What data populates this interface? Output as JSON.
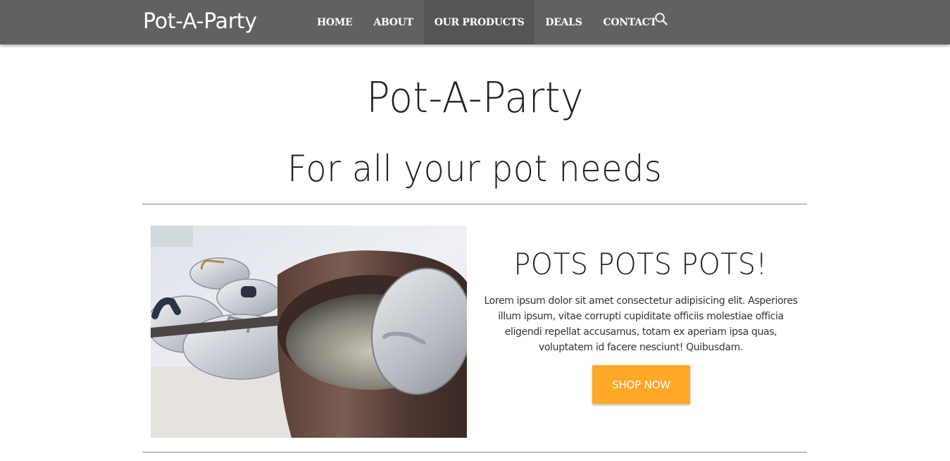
{
  "navbar": {
    "brand": "Pot-A-Party",
    "links": [
      {
        "label": "HOME"
      },
      {
        "label": "ABOUT"
      },
      {
        "label": "OUR PRODUCTS"
      },
      {
        "label": "DEALS"
      },
      {
        "label": "CONTACT"
      }
    ],
    "active_link": "OUR PRODUCTS",
    "search_icon": "search-icon"
  },
  "hero": {
    "title": "Pot-A-Party",
    "subtitle": "For all your pot needs"
  },
  "promo": {
    "image_alt": "pots-image",
    "heading": "POTS POTS POTS!",
    "text": "Lorem ipsum dolor sit amet consectetur adipisicing elit. Asperiores illum ipsum, vitae corrupti cupiditate officiis molestiae officia eligendi repellat accusamus, totam ex aperiam ipsa quas, voluptatem id facere nesciunt! Quibusdam.",
    "button_label": "SHOP NOW"
  },
  "colors": {
    "navbar_bg": "#616161",
    "navbar_active": "#555555",
    "accent": "#ffa726",
    "divider": "#8a8a8a"
  }
}
